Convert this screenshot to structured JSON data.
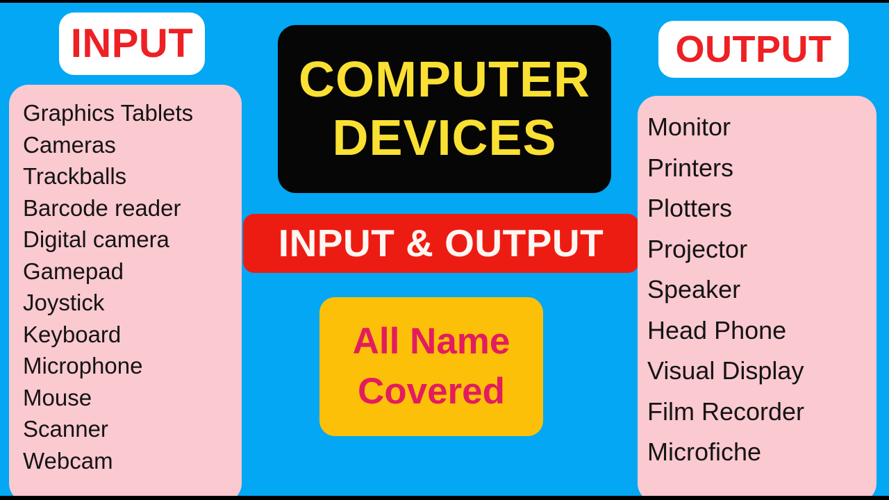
{
  "theme": {
    "background": "#03A7F4",
    "panel_pink": "#FBC9D0",
    "badge_white": "#FFFFFF",
    "badge_text_red": "#ED2024",
    "title_card_black": "#060606",
    "title_text_yellow": "#FAE033",
    "banner_red": "#ED1C13",
    "banner_text_white": "#FFF6F2",
    "covered_card_yellow": "#FDC009",
    "covered_text_pink": "#E31C5F",
    "list_text": "#141414",
    "frame_black": "#000000"
  },
  "title_card": {
    "line1": "COMPUTER",
    "line2": "DEVICES"
  },
  "io_banner": {
    "label": "INPUT & OUTPUT"
  },
  "covered_card": {
    "line1": "All Name",
    "line2": "Covered"
  },
  "input_section": {
    "heading": "INPUT",
    "items": [
      "Graphics Tablets",
      "Cameras",
      "Trackballs",
      "Barcode reader",
      "Digital camera",
      "Gamepad",
      "Joystick",
      "Keyboard",
      "Microphone",
      "Mouse",
      "Scanner",
      "Webcam"
    ]
  },
  "output_section": {
    "heading": "OUTPUT",
    "items": [
      "Monitor",
      "Printers",
      "Plotters",
      "Projector",
      "Speaker",
      "Head Phone",
      "Visual Display",
      "Film Recorder",
      "Microfiche"
    ]
  }
}
